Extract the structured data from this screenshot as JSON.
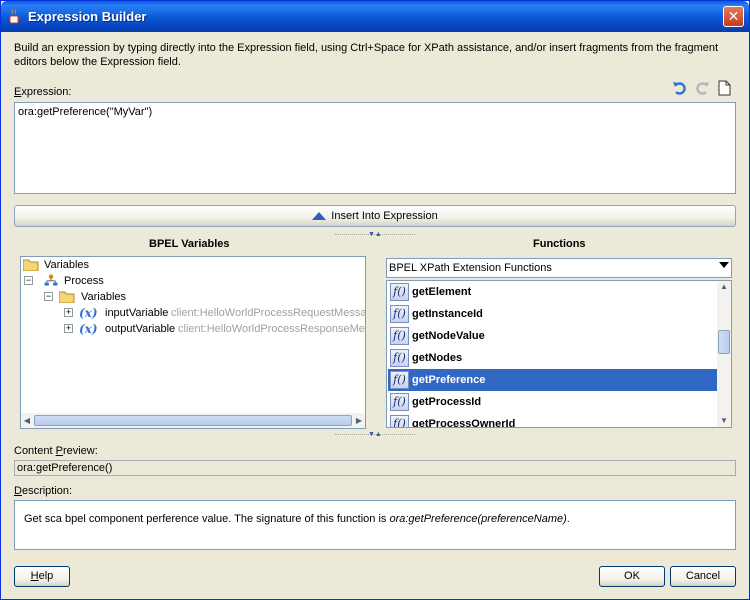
{
  "window": {
    "title": "Expression Builder",
    "close_symbol": "✕"
  },
  "intro_text": "Build an expression by typing directly into the Expression field, using Ctrl+Space for XPath assistance, and/or insert fragments from the fragment editors below the Expression field.",
  "expression": {
    "label_underlined": "E",
    "label_rest": "xpression:",
    "value": "ora:getPreference(\"MyVar\")",
    "toolbar_icons": [
      "undo-icon",
      "redo-icon",
      "new-document-icon"
    ]
  },
  "insert_button_label": "Insert Into Expression",
  "bpel_variables": {
    "title": "BPEL Variables",
    "tree": {
      "root": "Variables",
      "process": "Process",
      "variables": "Variables",
      "items": [
        {
          "name": "inputVariable",
          "type": "client:HelloWorldProcessRequestMessage"
        },
        {
          "name": "outputVariable",
          "type": "client:HelloWorldProcessResponseMessage"
        }
      ],
      "var_symbol": "(x)"
    }
  },
  "functions": {
    "title": "Functions",
    "category": "BPEL XPath Extension Functions",
    "fx_symbol": "f()",
    "items": [
      {
        "name": "getElement"
      },
      {
        "name": "getInstanceId"
      },
      {
        "name": "getNodeValue"
      },
      {
        "name": "getNodes"
      },
      {
        "name": "getPreference"
      },
      {
        "name": "getProcessId"
      },
      {
        "name": "getProcessOwnerId"
      }
    ],
    "selected": "getPreference"
  },
  "content_preview": {
    "label_underlined": "P",
    "label_before": "Content ",
    "label_after": "review:",
    "value": "ora:getPreference()"
  },
  "description": {
    "label_underlined": "D",
    "label_rest": "escription:",
    "text": "Get sca bpel component perference value. The signature of this function is ",
    "signature": "ora:getPreference(preferenceName)",
    "text_end": "."
  },
  "buttons": {
    "help_underlined": "H",
    "help_rest": "elp",
    "ok": "OK",
    "cancel": "Cancel"
  },
  "colors": {
    "selection": "#3168c4",
    "titlebar": "#0a57d6",
    "dialog_bg": "#ece9d8"
  }
}
